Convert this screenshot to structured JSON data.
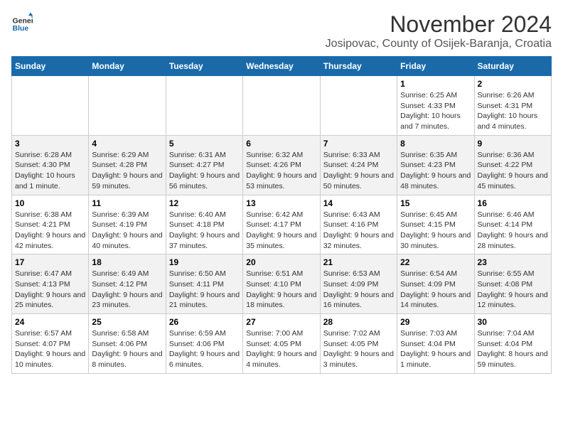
{
  "header": {
    "logo_general": "General",
    "logo_blue": "Blue",
    "month_title": "November 2024",
    "location": "Josipovac, County of Osijek-Baranja, Croatia"
  },
  "weekdays": [
    "Sunday",
    "Monday",
    "Tuesday",
    "Wednesday",
    "Thursday",
    "Friday",
    "Saturday"
  ],
  "weeks": [
    [
      {
        "day": "",
        "info": ""
      },
      {
        "day": "",
        "info": ""
      },
      {
        "day": "",
        "info": ""
      },
      {
        "day": "",
        "info": ""
      },
      {
        "day": "",
        "info": ""
      },
      {
        "day": "1",
        "info": "Sunrise: 6:25 AM\nSunset: 4:33 PM\nDaylight: 10 hours and 7 minutes."
      },
      {
        "day": "2",
        "info": "Sunrise: 6:26 AM\nSunset: 4:31 PM\nDaylight: 10 hours and 4 minutes."
      }
    ],
    [
      {
        "day": "3",
        "info": "Sunrise: 6:28 AM\nSunset: 4:30 PM\nDaylight: 10 hours and 1 minute."
      },
      {
        "day": "4",
        "info": "Sunrise: 6:29 AM\nSunset: 4:28 PM\nDaylight: 9 hours and 59 minutes."
      },
      {
        "day": "5",
        "info": "Sunrise: 6:31 AM\nSunset: 4:27 PM\nDaylight: 9 hours and 56 minutes."
      },
      {
        "day": "6",
        "info": "Sunrise: 6:32 AM\nSunset: 4:26 PM\nDaylight: 9 hours and 53 minutes."
      },
      {
        "day": "7",
        "info": "Sunrise: 6:33 AM\nSunset: 4:24 PM\nDaylight: 9 hours and 50 minutes."
      },
      {
        "day": "8",
        "info": "Sunrise: 6:35 AM\nSunset: 4:23 PM\nDaylight: 9 hours and 48 minutes."
      },
      {
        "day": "9",
        "info": "Sunrise: 6:36 AM\nSunset: 4:22 PM\nDaylight: 9 hours and 45 minutes."
      }
    ],
    [
      {
        "day": "10",
        "info": "Sunrise: 6:38 AM\nSunset: 4:21 PM\nDaylight: 9 hours and 42 minutes."
      },
      {
        "day": "11",
        "info": "Sunrise: 6:39 AM\nSunset: 4:19 PM\nDaylight: 9 hours and 40 minutes."
      },
      {
        "day": "12",
        "info": "Sunrise: 6:40 AM\nSunset: 4:18 PM\nDaylight: 9 hours and 37 minutes."
      },
      {
        "day": "13",
        "info": "Sunrise: 6:42 AM\nSunset: 4:17 PM\nDaylight: 9 hours and 35 minutes."
      },
      {
        "day": "14",
        "info": "Sunrise: 6:43 AM\nSunset: 4:16 PM\nDaylight: 9 hours and 32 minutes."
      },
      {
        "day": "15",
        "info": "Sunrise: 6:45 AM\nSunset: 4:15 PM\nDaylight: 9 hours and 30 minutes."
      },
      {
        "day": "16",
        "info": "Sunrise: 6:46 AM\nSunset: 4:14 PM\nDaylight: 9 hours and 28 minutes."
      }
    ],
    [
      {
        "day": "17",
        "info": "Sunrise: 6:47 AM\nSunset: 4:13 PM\nDaylight: 9 hours and 25 minutes."
      },
      {
        "day": "18",
        "info": "Sunrise: 6:49 AM\nSunset: 4:12 PM\nDaylight: 9 hours and 23 minutes."
      },
      {
        "day": "19",
        "info": "Sunrise: 6:50 AM\nSunset: 4:11 PM\nDaylight: 9 hours and 21 minutes."
      },
      {
        "day": "20",
        "info": "Sunrise: 6:51 AM\nSunset: 4:10 PM\nDaylight: 9 hours and 18 minutes."
      },
      {
        "day": "21",
        "info": "Sunrise: 6:53 AM\nSunset: 4:09 PM\nDaylight: 9 hours and 16 minutes."
      },
      {
        "day": "22",
        "info": "Sunrise: 6:54 AM\nSunset: 4:09 PM\nDaylight: 9 hours and 14 minutes."
      },
      {
        "day": "23",
        "info": "Sunrise: 6:55 AM\nSunset: 4:08 PM\nDaylight: 9 hours and 12 minutes."
      }
    ],
    [
      {
        "day": "24",
        "info": "Sunrise: 6:57 AM\nSunset: 4:07 PM\nDaylight: 9 hours and 10 minutes."
      },
      {
        "day": "25",
        "info": "Sunrise: 6:58 AM\nSunset: 4:06 PM\nDaylight: 9 hours and 8 minutes."
      },
      {
        "day": "26",
        "info": "Sunrise: 6:59 AM\nSunset: 4:06 PM\nDaylight: 9 hours and 6 minutes."
      },
      {
        "day": "27",
        "info": "Sunrise: 7:00 AM\nSunset: 4:05 PM\nDaylight: 9 hours and 4 minutes."
      },
      {
        "day": "28",
        "info": "Sunrise: 7:02 AM\nSunset: 4:05 PM\nDaylight: 9 hours and 3 minutes."
      },
      {
        "day": "29",
        "info": "Sunrise: 7:03 AM\nSunset: 4:04 PM\nDaylight: 9 hours and 1 minute."
      },
      {
        "day": "30",
        "info": "Sunrise: 7:04 AM\nSunset: 4:04 PM\nDaylight: 8 hours and 59 minutes."
      }
    ]
  ]
}
